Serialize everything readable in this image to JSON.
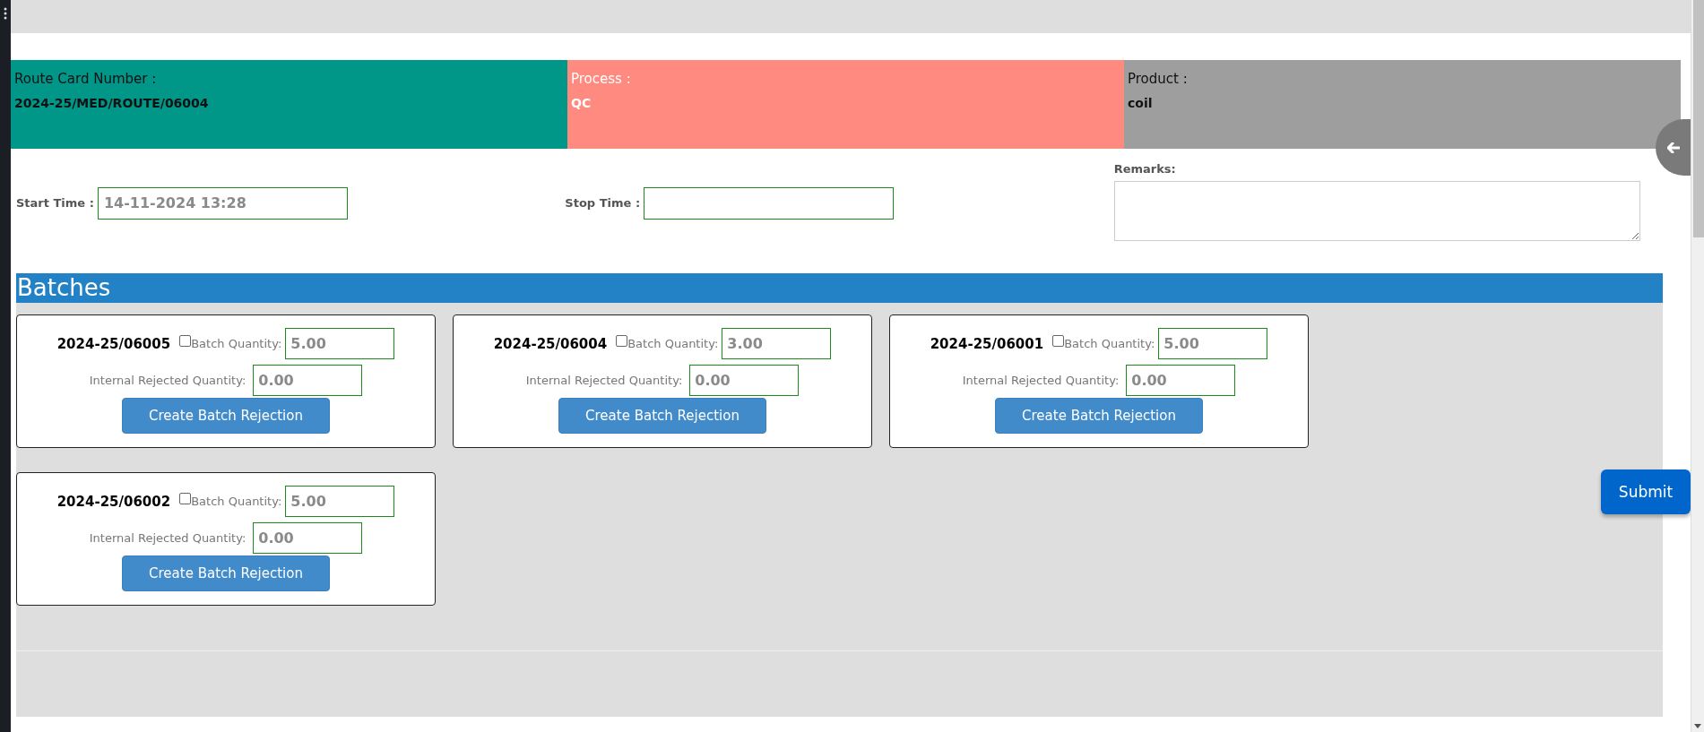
{
  "header": [
    {
      "kind": "route",
      "label": "Route Card Number :",
      "value": "2024-25/MED/ROUTE/06004",
      "color": "#009688"
    },
    {
      "kind": "process",
      "label": "Process :",
      "value": "QC",
      "color": "#ff8a80"
    },
    {
      "kind": "product",
      "label": "Product :",
      "value": "coil",
      "color": "#9e9e9e"
    }
  ],
  "start_time": {
    "label": "Start Time :",
    "value": "14-11-2024 13:28"
  },
  "stop_time": {
    "label": "Stop Time :"
  },
  "remarks": {
    "label": "Remarks:"
  },
  "batches_title": "Batches",
  "batches": [
    {
      "batch_no": "2024-25/06005",
      "checked": false,
      "quantity_label": "Batch Quantity:",
      "quantity": "5.00",
      "rejected_label": "Internal Rejected Quantity:",
      "rejected": "0.00",
      "button": "Create Batch Rejection"
    },
    {
      "batch_no": "2024-25/06004",
      "checked": false,
      "quantity_label": "Batch Quantity:",
      "quantity": "3.00",
      "rejected_label": "Internal Rejected Quantity:",
      "rejected": "0.00",
      "button": "Create Batch Rejection"
    },
    {
      "batch_no": "2024-25/06001",
      "checked": false,
      "quantity_label": "Batch Quantity:",
      "quantity": "5.00",
      "rejected_label": "Internal Rejected Quantity:",
      "rejected": "0.00",
      "button": "Create Batch Rejection"
    },
    {
      "batch_no": "2024-25/06002",
      "checked": false,
      "quantity_label": "Batch Quantity:",
      "quantity": "5.00",
      "rejected_label": "Internal Rejected Quantity:",
      "rejected": "0.00",
      "button": "Create Batch Rejection"
    }
  ],
  "submit": "Submit"
}
